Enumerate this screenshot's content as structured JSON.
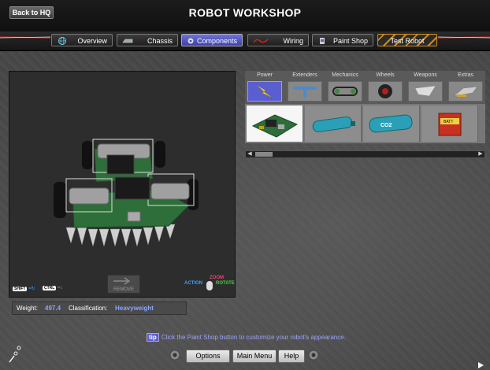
{
  "header": {
    "back_label": "Back to HQ",
    "title": "ROBOT WORKSHOP"
  },
  "nav": {
    "tabs": [
      {
        "label": "Overview",
        "icon": "globe-icon"
      },
      {
        "label": "Chassis",
        "icon": "chassis-icon"
      },
      {
        "label": "Components",
        "icon": "gear-icon",
        "active": true
      },
      {
        "label": "Wiring",
        "icon": "wire-icon"
      },
      {
        "label": "Paint Shop",
        "icon": "paint-icon"
      },
      {
        "label": "Test Robot",
        "icon": ""
      }
    ]
  },
  "viewport": {
    "remove_label": "REMOVE",
    "shift_key": "SHIFT",
    "ctrl_key": "CTRL",
    "zoom_label": "ZOOM",
    "action_label": "ACTION",
    "rotate_label": "ROTATE"
  },
  "info": {
    "weight_label": "Weight:",
    "weight_value": "497.4",
    "classification_label": "Classification:",
    "classification_value": "Heavyweight"
  },
  "parts": {
    "categories": [
      {
        "label": "Power",
        "icon": "lightning-icon",
        "active": true
      },
      {
        "label": "Extenders",
        "icon": "extender-icon"
      },
      {
        "label": "Mechanics",
        "icon": "belt-icon"
      },
      {
        "label": "Wheels",
        "icon": "wheel-icon"
      },
      {
        "label": "Weapons",
        "icon": "blade-icon"
      },
      {
        "label": "Extras",
        "icon": "extras-icon"
      }
    ],
    "items": [
      {
        "name": "circuit-board-part",
        "selected": true
      },
      {
        "name": "blue-cylinder-part",
        "selected": false
      },
      {
        "name": "co2-canister-part",
        "selected": false
      },
      {
        "name": "red-battery-part",
        "selected": false
      }
    ],
    "co2_text": "CO2",
    "battery_text": "BATT"
  },
  "tip": {
    "badge": "tip",
    "text": "Click the Paint Shop button to customize your robot's appearance."
  },
  "footer": {
    "options_label": "Options",
    "main_menu_label": "Main Menu",
    "help_label": "Help"
  },
  "colors": {
    "accent": "#5a5ed0",
    "value_text": "#8aa4ff",
    "warning": "#c98a1c",
    "pcb_green": "#2e6e3a"
  }
}
